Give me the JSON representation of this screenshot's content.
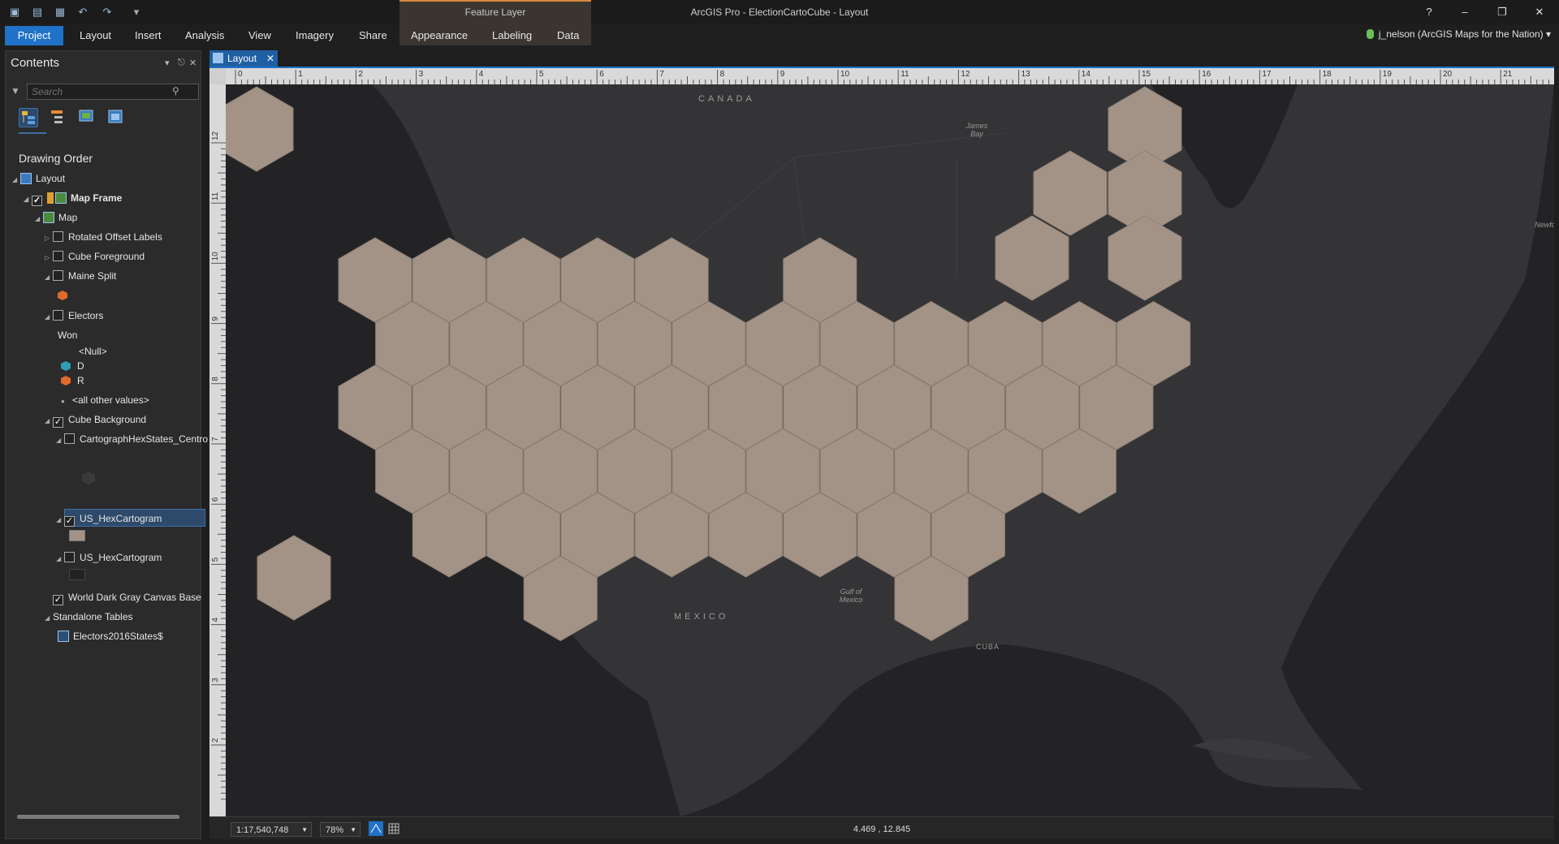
{
  "app": {
    "title": "ArcGIS Pro - ElectionCartoCube - Layout",
    "context_header": "Feature Layer",
    "help": "?",
    "user": "j_nelson (ArcGIS Maps for the Nation) ▾"
  },
  "quick_access": [
    "project-icon",
    "open-icon",
    "save-icon",
    "undo-icon",
    "redo-icon",
    "customize-icon"
  ],
  "ribbon": {
    "tabs": [
      "Project",
      "Layout",
      "Insert",
      "Analysis",
      "View",
      "Imagery",
      "Share",
      "Appearance",
      "Labeling",
      "Data"
    ],
    "active_tab": "Project"
  },
  "contents": {
    "title": "Contents",
    "search_placeholder": "Search",
    "drawing_order": "Drawing Order",
    "tree": {
      "layout": "Layout",
      "map_frame": "Map Frame",
      "map": "Map",
      "rotated_offset_labels": "Rotated Offset Labels",
      "cube_foreground": "Cube Foreground",
      "maine_split": "Maine Split",
      "electors": "Electors",
      "won_field": "Won",
      "null_value": "<Null>",
      "d_value": "D",
      "r_value": "R",
      "other_values": "<all other values>",
      "cube_background": "Cube Background",
      "centroids": "CartographHexStates_Centro",
      "hex_selected": "US_HexCartogram",
      "hex_second": "US_HexCartogram",
      "basemap": "World Dark Gray Canvas Base",
      "standalone_tables": "Standalone Tables",
      "electors_table": "Electors2016States$"
    },
    "checked": {
      "map_frame": true,
      "rotated_offset_labels": false,
      "cube_foreground": false,
      "maine_split": false,
      "electors": false,
      "cube_background": true,
      "centroids": false,
      "hex_selected": true,
      "hex_second": false,
      "basemap": true
    },
    "check_mark": "✓"
  },
  "layout_view": {
    "tab_label": "Layout",
    "close_glyph": "✕",
    "top_ruler": [
      "0",
      "1",
      "2",
      "3",
      "4",
      "5",
      "6",
      "7",
      "8",
      "9",
      "10",
      "11",
      "12",
      "13",
      "14",
      "15",
      "16",
      "17",
      "18",
      "19",
      "20",
      "21"
    ],
    "left_ruler": [
      "12",
      "11",
      "10",
      "9",
      "8",
      "7",
      "6",
      "5",
      "4",
      "3",
      "2"
    ],
    "map_labels": {
      "canada": "CANADA",
      "mexico": "MEXICO",
      "cuba": "CUBA",
      "james_bay": "James Bay",
      "gulf": "Gulf of Mexico",
      "newfoundland": "Newfo"
    }
  },
  "colors": {
    "hex_fill": "#a39386",
    "hex_stroke": "#8d7f74",
    "land": "#343436",
    "water": "#232325",
    "democrat": "#2c9fb2",
    "republican": "#e0692c",
    "accent": "#1f72c7"
  },
  "status": {
    "scale": "1:17,540,748",
    "zoom": "78%",
    "coordinates": "4.469 , 12.845"
  }
}
